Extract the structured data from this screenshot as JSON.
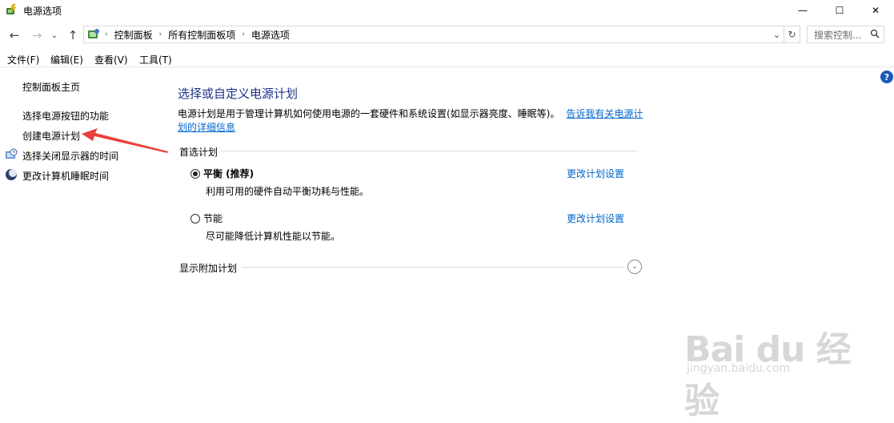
{
  "window": {
    "title": "电源选项",
    "minimize": "—",
    "maximize": "☐",
    "close": "✕"
  },
  "nav": {
    "back": "←",
    "forward": "→",
    "recent": "⌄",
    "up": "↑",
    "breadcrumbs": [
      "控制面板",
      "所有控制面板项",
      "电源选项"
    ],
    "separator": "›",
    "dropdown": "⌄",
    "refresh": "↻",
    "search_placeholder": "搜索控制..."
  },
  "menu": [
    "文件(F)",
    "编辑(E)",
    "查看(V)",
    "工具(T)"
  ],
  "sidebar": {
    "home": "控制面板主页",
    "links": [
      "选择电源按钮的功能",
      "创建电源计划",
      "选择关闭显示器的时间",
      "更改计算机睡眠时间"
    ]
  },
  "main": {
    "heading": "选择或自定义电源计划",
    "desc_line1": "电源计划是用于管理计算机如何使用电源的一套硬件和系统设置(如显示器亮度、睡眠等)。",
    "desc_link1": "告诉我有关电源计",
    "desc_link2": "划的详细信息",
    "preferred_label": "首选计划",
    "plans": [
      {
        "name": "平衡 (推荐)",
        "desc": "利用可用的硬件自动平衡功耗与性能。",
        "selected": true,
        "change": "更改计划设置"
      },
      {
        "name": "节能",
        "desc": "尽可能降低计算机性能以节能。",
        "selected": false,
        "change": "更改计划设置"
      }
    ],
    "additional_label": "显示附加计划",
    "expand": "⌄",
    "help": "?"
  },
  "watermark": {
    "brand": "Bai du 经验",
    "url": "jingyan.baidu.com"
  },
  "colors": {
    "heading": "#1e3287",
    "link": "#0066cc",
    "arrow": "#e8413c"
  }
}
